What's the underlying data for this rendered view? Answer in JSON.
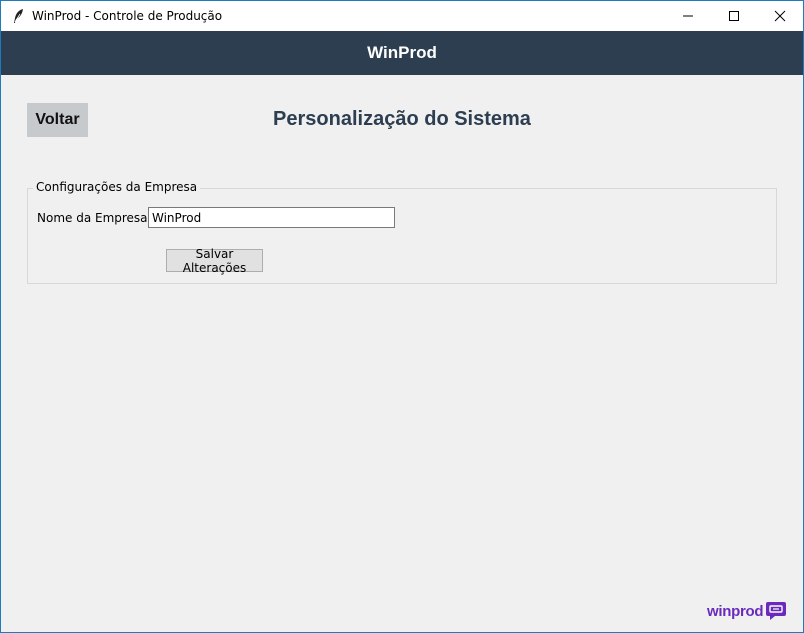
{
  "window": {
    "title": "WinProd - Controle de Produção",
    "icons": {
      "app": "feather-icon",
      "minimize": "minimize-icon",
      "maximize": "maximize-icon",
      "close": "close-icon"
    }
  },
  "header": {
    "title": "WinProd"
  },
  "page": {
    "back_label": "Voltar",
    "title": "Personalização do Sistema"
  },
  "company_settings": {
    "legend": "Configurações da Empresa",
    "name_label": "Nome da Empresa:",
    "name_value": "WinProd",
    "save_label": "Salvar Alterações"
  },
  "branding": {
    "logo_text": "winprod",
    "logo_icon": "chat-bubble-icon",
    "header_color": "#2c3e50",
    "logo_color": "#6a2bbd"
  }
}
